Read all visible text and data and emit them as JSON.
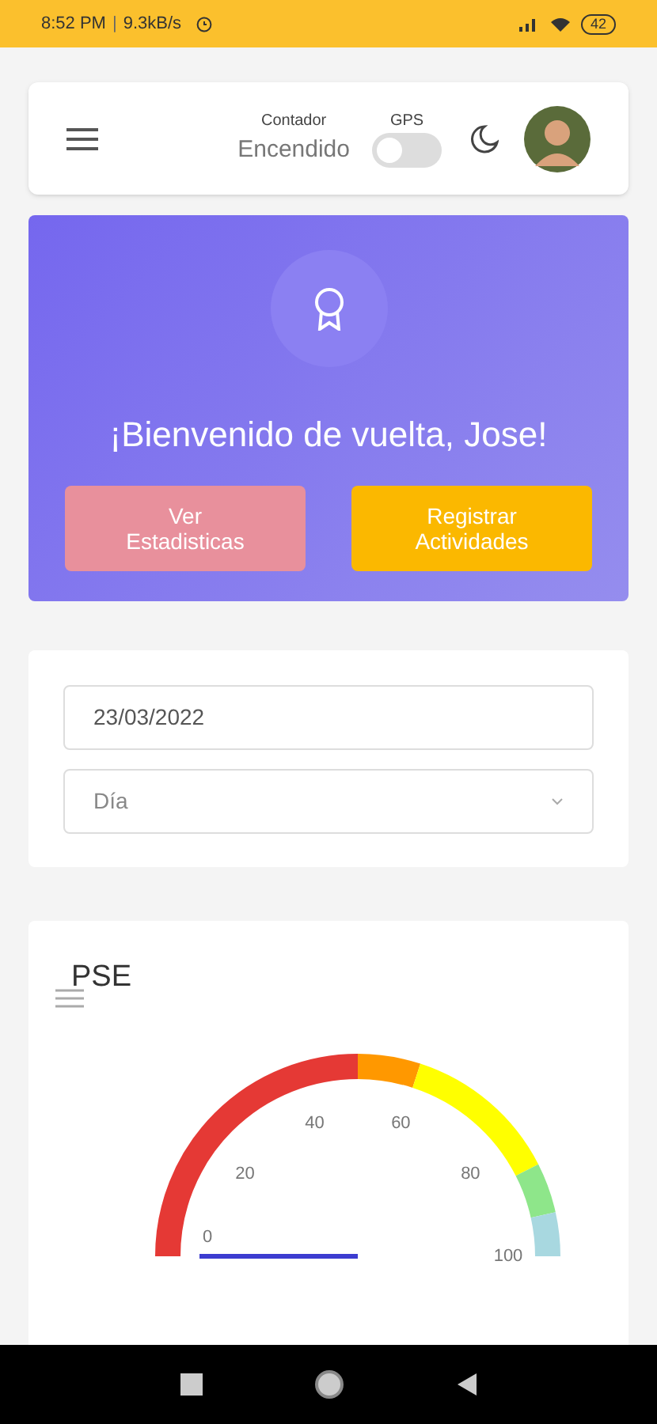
{
  "status_bar": {
    "time": "8:52 PM",
    "separator": "|",
    "speed": "9.3kB/s",
    "battery": "42"
  },
  "header": {
    "counter_label": "Contador",
    "counter_value": "Encendido",
    "gps_label": "GPS",
    "gps_on": false
  },
  "hero": {
    "title": "¡Bienvenido de vuelta, Jose!",
    "buttons": [
      {
        "label": "Ver Estadisticas",
        "kind": "stats"
      },
      {
        "label": "Registrar Actividades",
        "kind": "register"
      }
    ]
  },
  "filters": {
    "date": "23/03/2022",
    "period": "Día"
  },
  "gauge": {
    "title": "PSE",
    "segments": [
      {
        "color": "#e53935"
      },
      {
        "color": "#ff9800"
      },
      {
        "color": "#ffff00"
      },
      {
        "color": "#8ee68a"
      },
      {
        "color": "#a8d8e0"
      }
    ],
    "ticks": [
      "0",
      "20",
      "40",
      "60",
      "80",
      "100"
    ]
  }
}
